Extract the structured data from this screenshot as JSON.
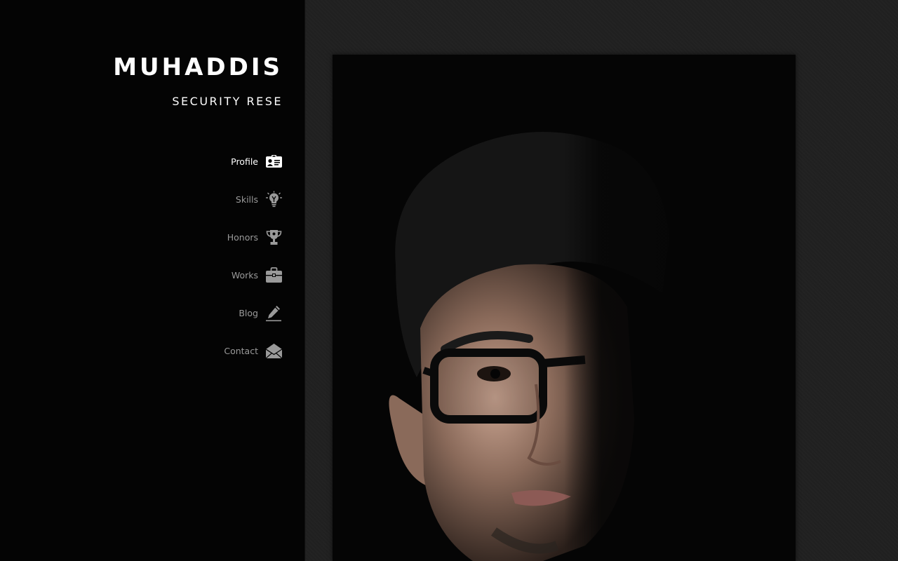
{
  "header": {
    "title": "MUHADDIS",
    "subtitle": "SECURITY RESE"
  },
  "nav": {
    "items": [
      {
        "label": "Profile",
        "icon": "id-card-icon",
        "active": true
      },
      {
        "label": "Skills",
        "icon": "lightbulb-icon",
        "active": false
      },
      {
        "label": "Honors",
        "icon": "trophy-icon",
        "active": false
      },
      {
        "label": "Works",
        "icon": "briefcase-icon",
        "active": false
      },
      {
        "label": "Blog",
        "icon": "pencil-icon",
        "active": false
      },
      {
        "label": "Contact",
        "icon": "envelope-icon",
        "active": false
      }
    ]
  },
  "main": {
    "photo": {
      "subject": "profile-portrait"
    }
  },
  "colors": {
    "sidebar_bg": "#040404",
    "main_bg": "#202020",
    "text_active": "#ffffff",
    "text_inactive": "#9a9a9a"
  }
}
